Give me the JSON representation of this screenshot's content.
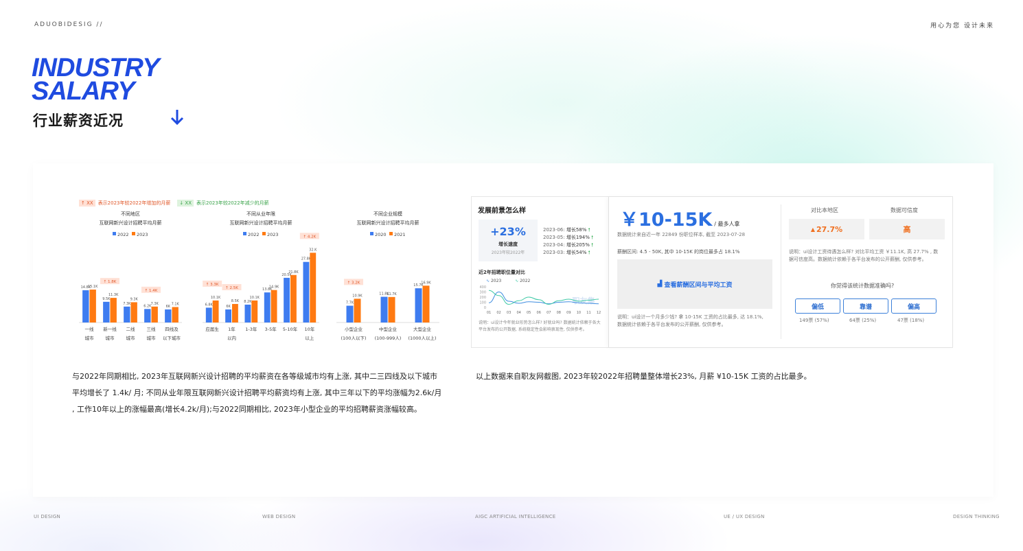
{
  "header": {
    "brand": "ADUOBIDESIG  //",
    "slogan": "用心为您  设计未来",
    "title_en_line1": "INDUSTRY",
    "title_en_line2": "SALARY",
    "title_cn": "行业薪资近况",
    "arrow_icon": "arrow-down-icon",
    "accent_color": "#1f4be0"
  },
  "legend_notes": {
    "up_tag": "↑ XX",
    "up_text": "表示2023年较2022年增加的月薪",
    "down_tag": "↓ XX",
    "down_text": "表示2023年较2022年减少的月薪"
  },
  "chart_data": [
    {
      "type": "bar",
      "title": "不同地区\n互联网新兴设计招聘平均月薪",
      "title_line1": "不同地区",
      "title_line2": "互联网新兴设计招聘平均月薪",
      "categories": [
        "一线\n城市",
        "新一线\n城市",
        "二线\n城市",
        "三线\n城市",
        "四线及\n以下城市"
      ],
      "series": [
        {
          "name": "2022",
          "color": "#3e7cf0",
          "values": [
            14.8,
            9.5,
            7.3,
            6.2,
            6.0
          ],
          "labels": [
            "14.8K",
            "9.5K",
            "7.3K",
            "6.2K",
            "6K"
          ]
        },
        {
          "name": "2023",
          "color": "#ff7a12",
          "values": [
            15.1,
            11.3,
            9.3,
            7.3,
            7.1
          ],
          "labels": [
            "15.1K",
            "11.3K",
            "9.3K",
            "7.3K",
            "7.1K"
          ]
        }
      ],
      "annotations": [
        {
          "text": "↑ 1.8K",
          "category_index": 1
        },
        {
          "text": "↑ 1.4K",
          "category_index": 3
        }
      ],
      "ylim": [
        0,
        34
      ]
    },
    {
      "type": "bar",
      "title": "不同从业年限\n互联网新兴设计招聘平均月薪",
      "title_line1": "不同从业年限",
      "title_line2": "互联网新兴设计招聘平均月薪",
      "categories": [
        "应届生",
        "1年\n以内",
        "1-3年",
        "3-5年",
        "5-10年",
        "10年\n以上"
      ],
      "series": [
        {
          "name": "2022",
          "color": "#3e7cf0",
          "values": [
            6.8,
            6.0,
            8.2,
            13.8,
            20.5,
            27.8
          ],
          "labels": [
            "6.8K",
            "6K",
            "8.2K",
            "13.8K",
            "20.5K",
            "27.8K"
          ]
        },
        {
          "name": "2023",
          "color": "#ff7a12",
          "values": [
            10.1,
            8.5,
            10.1,
            14.9,
            21.8,
            32.0
          ],
          "labels": [
            "10.1K",
            "8.5K",
            "10.1K",
            "14.9K",
            "21.8K",
            "32.K"
          ]
        }
      ],
      "annotations": [
        {
          "text": "↑ 3.3K",
          "category_index": 0
        },
        {
          "text": "↑ 2.5K",
          "category_index": 1
        },
        {
          "text": "↑ 4.2K",
          "category_index": 5
        }
      ],
      "ylim": [
        0,
        34
      ]
    },
    {
      "type": "bar",
      "title": "不同企业规模\n互联网新兴设计招聘平均月薪",
      "title_line1": "不同企业规模",
      "title_line2": "互联网新兴设计招聘平均月薪",
      "categories": [
        "小型企业\n(100人以下)",
        "中型企业\n(100-999人)",
        "大型企业\n(1000人以上)"
      ],
      "series": [
        {
          "name": "2020",
          "color": "#3e7cf0",
          "values": [
            7.7,
            11.8,
            15.7
          ],
          "labels": [
            "7.7K",
            "11.8K",
            "15.7K"
          ]
        },
        {
          "name": "2021",
          "color": "#ff7a12",
          "values": [
            10.9,
            11.7,
            16.9
          ],
          "labels": [
            "10.9K",
            "11.7K",
            "16.9K"
          ]
        }
      ],
      "annotations": [
        {
          "text": "↑ 3.2K",
          "category_index": 0
        }
      ],
      "ylim": [
        0,
        34
      ]
    },
    {
      "type": "line",
      "title": "近2年招聘职位量对比",
      "x": [
        "01",
        "02",
        "03",
        "04",
        "05",
        "06",
        "07",
        "08",
        "09",
        "10",
        "11",
        "12"
      ],
      "yticks": [
        "400",
        "300",
        "200",
        "100",
        "0"
      ],
      "ylim": [
        0,
        400
      ],
      "series": [
        {
          "name": "2023",
          "color": "#3f8de0",
          "values": [
            90,
            300,
            120,
            80,
            110,
            100,
            70,
            100,
            110,
            90,
            80,
            70
          ]
        },
        {
          "name": "2022",
          "color": "#3fc9a6",
          "values": [
            330,
            230,
            60,
            130,
            200,
            150,
            60,
            130,
            160,
            120,
            140,
            160
          ]
        }
      ],
      "watermark": "职友集"
    }
  ],
  "left_note": {
    "line1": "与2022年同期相比, 2023年互联网新兴设计招聘的平均薪资在各等级城市均有上涨, 其中二三四线及以下城市",
    "line2": "平均增长了  1.4k/ 月; 不同从业年限互联网新兴设计招聘平均薪资均有上涨, 其中三年以下的平均涨幅为2.6k/月",
    "line3": ", 工作10年以上的涨幅最高(增长4.2k/月);与2022同期相比, 2023年小型企业的平均招聘薪资涨幅较高。"
  },
  "right_note": "以上数据来自职友网截图, 2023年较2022年招聘量整体增长23%, 月薪 ¥10-15K 工资的占比最多。",
  "growth": {
    "heading": "发展前景怎么样",
    "big_value": "+23%",
    "label": "增长速度",
    "sub": "2023年较2022年",
    "rows": [
      {
        "month": "2023-06:",
        "text": "增长58%"
      },
      {
        "month": "2023-05:",
        "text": "增长194%"
      },
      {
        "month": "2023-04:",
        "text": "增长205%"
      },
      {
        "month": "2023-03:",
        "text": "增长54%"
      }
    ],
    "chart_heading": "近2年招聘职位量对比",
    "legend_2023": "2023",
    "legend_2022": "2022",
    "note": "说明：ui设计今年就业形势怎么样? 好就业吗? 数据统计依赖于各大平台发布的公开数据, 系统稳定性会影响衷现性, 仅供参考。"
  },
  "salary": {
    "value": "￥10-15K",
    "unit": "/ 最多人拿",
    "source": "数据统计来自近一年 22849 份职位样本, 截至 2023-07-28",
    "range": "薪酬区间: 4.5 - 50K, 其中 10-15K 的岗位最多占 18.1%",
    "link": "查看薪酬区间与平均工资",
    "note": "说明：ui设计一个月多少钱? 拿 10-15K 工资的占比最多, 达 18.1%, 数据统计依赖于各平台发布的公开薪酬, 仅供参考。"
  },
  "compare": {
    "head1": "对比本地区",
    "head2": "数据可信度",
    "val1": "27.7%",
    "val2": "高",
    "note": "说明：ui设计工资待遇怎么样? 对比平均工资 ￥11.1K, 高 27.7% , 数据可信度高。数据统计依赖于各平台发布的公开薪酬, 仅供参考。",
    "question": "你觉得该统计数据准确吗?",
    "buttons": [
      {
        "label": "偏低",
        "votes": "149票 (57%)"
      },
      {
        "label": "靠谱",
        "votes": "64票 (25%)"
      },
      {
        "label": "偏高",
        "votes": "47票 (18%)"
      }
    ]
  },
  "footer": {
    "item1": "UI DESIGN",
    "item2": "WEB DESIGN",
    "item3": "AIGC ARTIFICIAL INTELLIGENCE",
    "item4": "UE / UX DESIGN",
    "item5": "DESIGN THINKING"
  }
}
